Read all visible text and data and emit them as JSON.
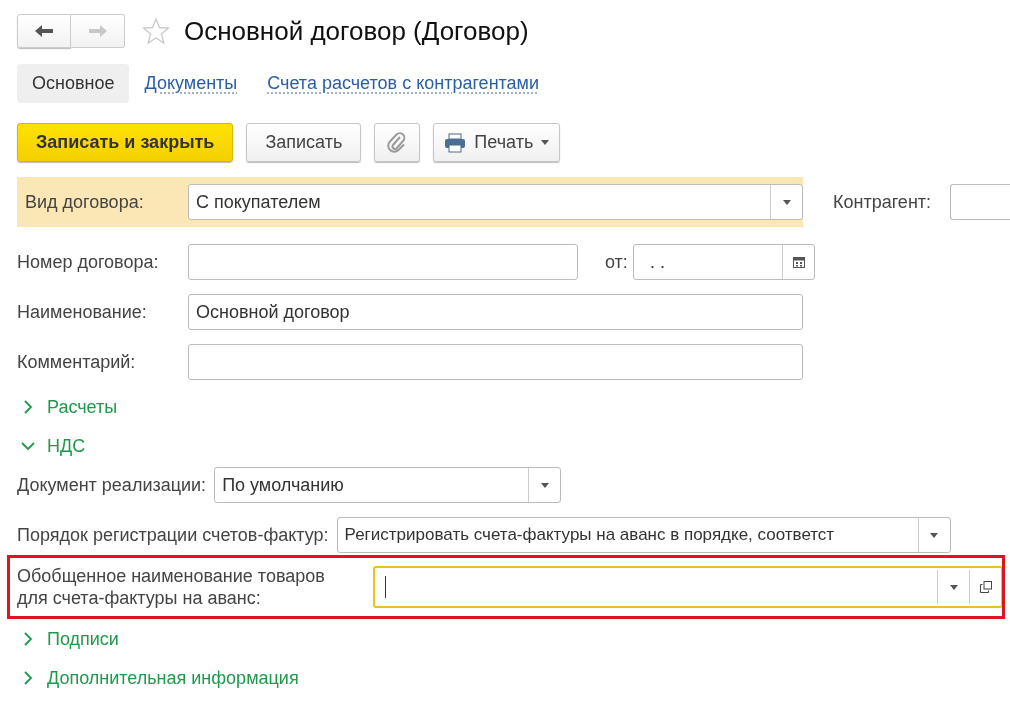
{
  "nav": {
    "back": {
      "disabled": false
    },
    "forward": {
      "disabled": true
    }
  },
  "favorite": false,
  "title": "Основной договор (Договор)",
  "tabs": [
    {
      "label": "Основное",
      "selected": true
    },
    {
      "label": "Документы",
      "selected": false
    },
    {
      "label": "Счета расчетов с контрагентами",
      "selected": false
    }
  ],
  "toolbar": [
    {
      "kind": "primary",
      "label": "Записать и закрыть"
    },
    {
      "kind": "button",
      "label": "Записать"
    },
    {
      "kind": "attach"
    },
    {
      "kind": "print",
      "label": "Печать"
    }
  ],
  "contract_type": {
    "label": "Вид договора:",
    "value": "С покупателем",
    "highlighted": true
  },
  "counterparty": {
    "label": "Контрагент:"
  },
  "number": {
    "label": "Номер договора:"
  },
  "date": {
    "label": "от:",
    "value": ".  ."
  },
  "name": {
    "label": "Наименование:",
    "value": "Основной договор"
  },
  "comment": {
    "label": "Комментарий:"
  },
  "sections": [
    {
      "title": "Расчеты",
      "expanded": false
    },
    {
      "title": "НДС",
      "expanded": true,
      "fields": [
        {
          "label": "Документ реализации:",
          "value": "По умолчанию",
          "kind": "select",
          "focused": false,
          "highlighted": false
        },
        {
          "label": "Порядок регистрации счетов-фактур:",
          "value": "Регистрировать счета-фактуры на аванс в порядке, соответст",
          "kind": "select",
          "focused": false,
          "highlighted": false
        },
        {
          "label": "Обобщенное наименование товаров для счета-фактуры на аванс:",
          "kind": "select_open",
          "focused": true,
          "highlighted": true
        }
      ]
    },
    {
      "title": "Подписи",
      "expanded": false
    },
    {
      "title": "Дополнительная информация",
      "expanded": false
    }
  ]
}
